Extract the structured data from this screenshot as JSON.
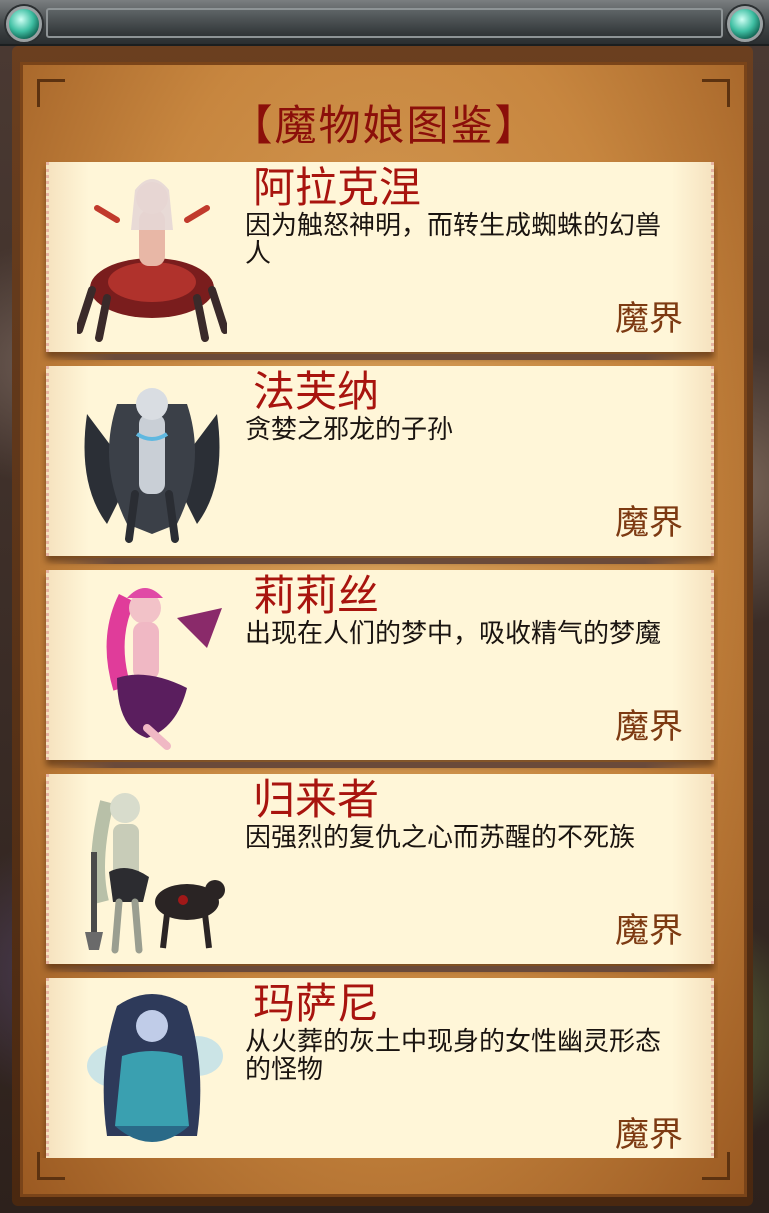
{
  "title": "【魔物娘图鉴】",
  "entries": [
    {
      "name": "阿拉克涅",
      "desc": "因为触怒神明，而转生成蜘蛛的幻兽人",
      "realm": "魔界",
      "portrait": "spider-girl-portrait"
    },
    {
      "name": "法芙纳",
      "desc": "贪婪之邪龙的子孙",
      "realm": "魔界",
      "portrait": "dragon-girl-portrait"
    },
    {
      "name": "莉莉丝",
      "desc": "出现在人们的梦中，吸收精气的梦魔",
      "realm": "魔界",
      "portrait": "succubus-portrait"
    },
    {
      "name": "归来者",
      "desc": "因强烈的复仇之心而苏醒的不死族",
      "realm": "魔界",
      "portrait": "undead-girl-portrait"
    },
    {
      "name": "玛萨尼",
      "desc": "从火葬的灰土中现身的女性幽灵形态的怪物",
      "realm": "魔界",
      "portrait": "ghost-girl-portrait"
    }
  ],
  "colors": {
    "title": "#8b0f0a",
    "name": "#a8140e",
    "realm": "#7d3a12",
    "card": "#fff6d8"
  }
}
